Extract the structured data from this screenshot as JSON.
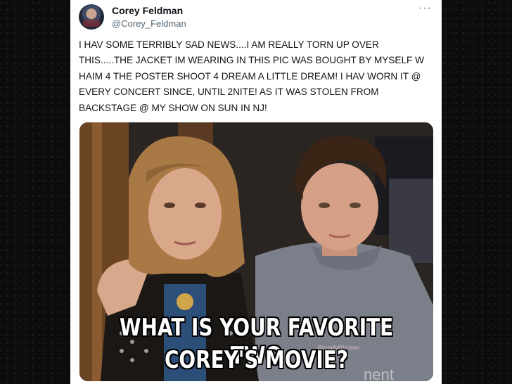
{
  "author": {
    "name": "Corey Feldman",
    "handle": "@Corey_Feldman"
  },
  "more_icon": "more-horizontal-icon",
  "tweet": {
    "text": "I HAV SOME TERRIBLY SAD NEWS....I AM REALLY TORN UP OVER THIS.....THE JACKET IM WEARING IN THIS PIC WAS BOUGHT BY MYSELF W HAIM 4 THE POSTER SHOOT 4 DREAM A LITTLE DREAM! I HAV WORN IT @ EVERY CONCERT SINCE, UNTIL 2NITE! AS IT WAS STOLEN FROM BACKSTAGE @ MY SHOW ON SUN IN NJ!"
  },
  "media": {
    "caption_line1": "WHAT IS YOUR FAVORITE TWO",
    "caption_line2": "COREY'S MOVIE?",
    "watermark": "@totally80sroom",
    "shirt_text": "nent"
  }
}
